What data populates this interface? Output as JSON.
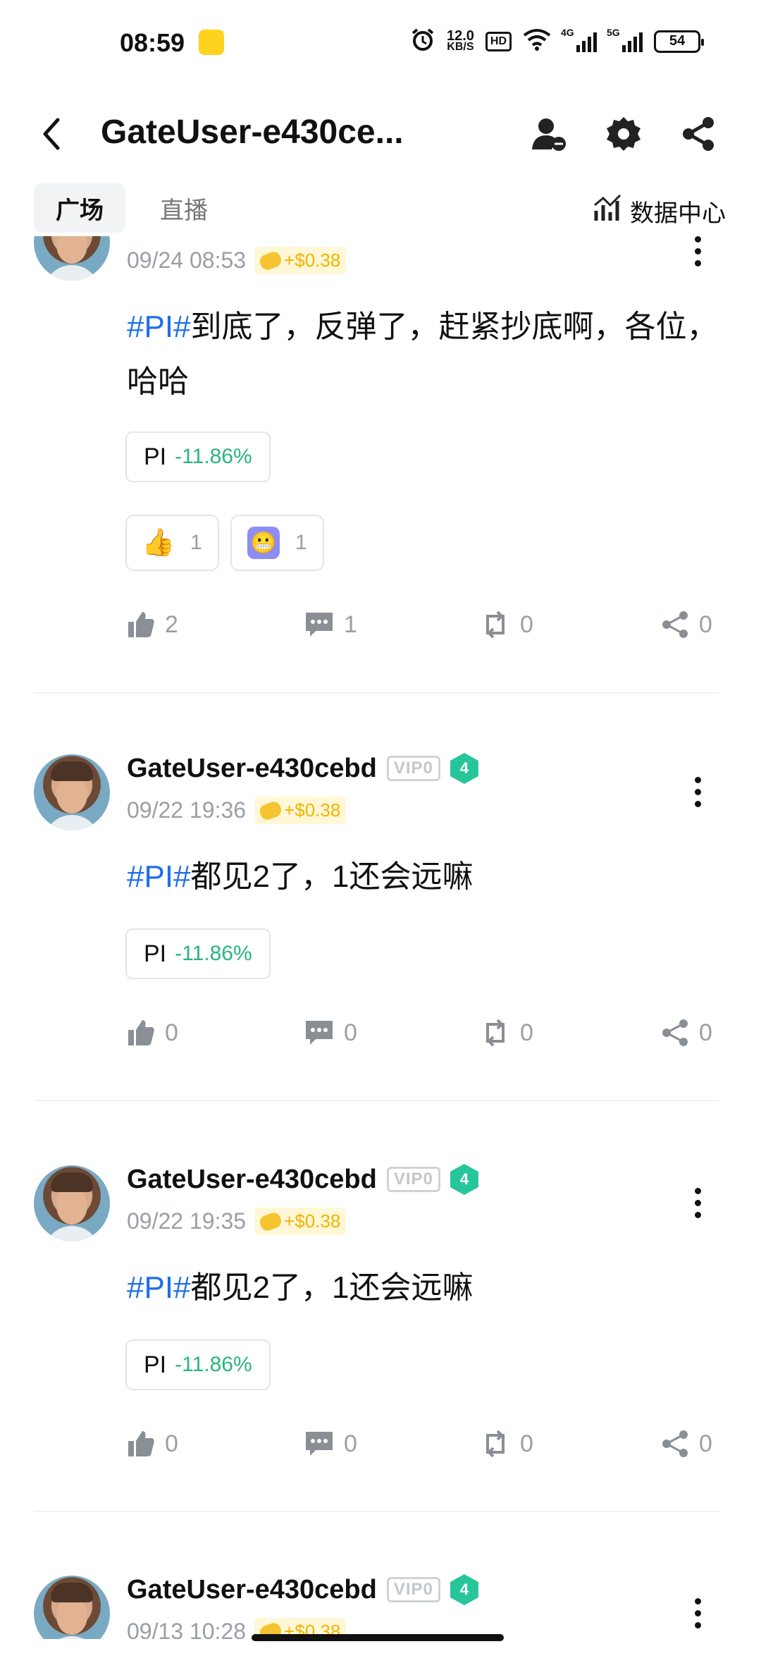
{
  "status_bar": {
    "time": "08:59",
    "net_speed_value": "12.0",
    "net_speed_unit": "KB/S",
    "hd_label": "HD",
    "sig1_label": "4G",
    "sig2_label": "5G",
    "battery": "54"
  },
  "header": {
    "title": "GateUser-e430ce..."
  },
  "tabs": {
    "plaza": "广场",
    "live": "直播",
    "data_center": "数据中心"
  },
  "posts": [
    {
      "time": "09/24 08:53",
      "tip": "+$0.38",
      "tag": "#PI#",
      "text": "到底了，反弹了，赶紧抄底啊，各位，哈哈",
      "coin": "PI",
      "change": "-11.86%",
      "reactions": [
        {
          "icon": "thumbs-up-emoji",
          "count": "1"
        },
        {
          "icon": "grimace-emoji",
          "count": "1"
        }
      ],
      "likes": "2",
      "comments": "1",
      "reposts": "0",
      "shares": "0"
    },
    {
      "username": "GateUser-e430cebd",
      "vip": "VIP0",
      "level": "4",
      "time": "09/22 19:36",
      "tip": "+$0.38",
      "tag": "#PI#",
      "text": "都见2了，1还会远嘛",
      "coin": "PI",
      "change": "-11.86%",
      "likes": "0",
      "comments": "0",
      "reposts": "0",
      "shares": "0"
    },
    {
      "username": "GateUser-e430cebd",
      "vip": "VIP0",
      "level": "4",
      "time": "09/22 19:35",
      "tip": "+$0.38",
      "tag": "#PI#",
      "text": "都见2了，1还会远嘛",
      "coin": "PI",
      "change": "-11.86%",
      "likes": "0",
      "comments": "0",
      "reposts": "0",
      "shares": "0"
    },
    {
      "username": "GateUser-e430cebd",
      "vip": "VIP0",
      "level": "4",
      "time": "09/13 10:28",
      "tip": "+$0.38"
    }
  ]
}
